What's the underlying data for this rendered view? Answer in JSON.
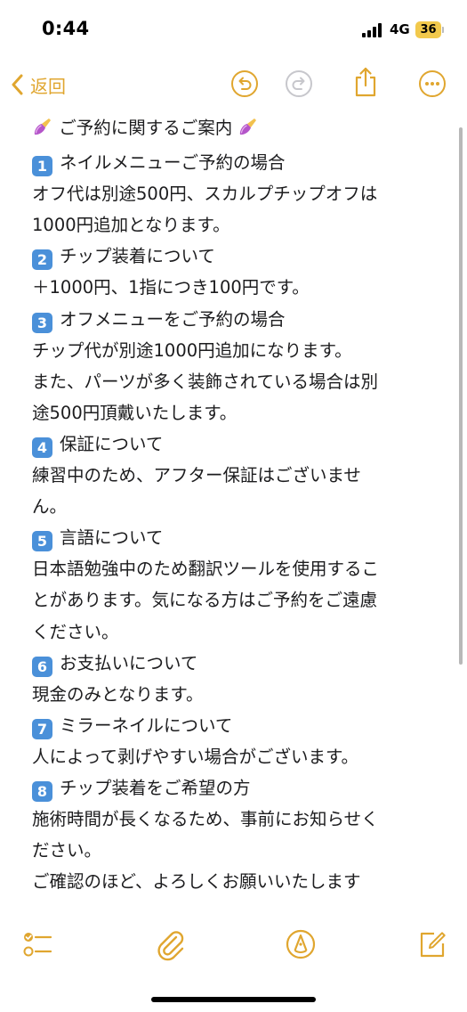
{
  "status_bar": {
    "time": "0:44",
    "network": "4G",
    "battery": "36"
  },
  "nav": {
    "back_label": "返回"
  },
  "colors": {
    "accent": "#e0a62f",
    "keycap": "#4a90d9"
  },
  "note": {
    "title": "ご予約に関するご案内",
    "sections": [
      {
        "number": "1",
        "heading": "ネイルメニューご予約の場合",
        "lines": [
          "オフ代は別途500円、スカルプチップオフは",
          "1000円追加となります。"
        ]
      },
      {
        "number": "2",
        "heading": "チップ装着について",
        "lines": [
          "＋1000円、1指につき100円です。"
        ]
      },
      {
        "number": "3",
        "heading": "オフメニューをご予約の場合",
        "lines": [
          "チップ代が別途1000円追加になります。",
          "また、パーツが多く装飾されている場合は別",
          "途500円頂戴いたします。"
        ]
      },
      {
        "number": "4",
        "heading": "保証について",
        "lines": [
          "練習中のため、アフター保証はございませ",
          "ん。"
        ]
      },
      {
        "number": "5",
        "heading": "言語について",
        "lines": [
          "日本語勉強中のため翻訳ツールを使用するこ",
          "とがあります。気になる方はご予約をご遠慮",
          "ください。"
        ]
      },
      {
        "number": "6",
        "heading": "お支払いについて",
        "lines": [
          "現金のみとなります。"
        ]
      },
      {
        "number": "7",
        "heading": "ミラーネイルについて",
        "lines": [
          "人によって剥げやすい場合がございます。"
        ]
      },
      {
        "number": "8",
        "heading": "チップ装着をご希望の方",
        "lines": [
          "施術時間が長くなるため、事前にお知らせく",
          "ださい。"
        ]
      }
    ],
    "closing": "ご確認のほど、よろしくお願いいたします"
  },
  "icons": {
    "back": "chevron-left-icon",
    "undo": "undo-icon",
    "redo": "redo-icon",
    "share": "share-icon",
    "more": "ellipsis-icon",
    "checklist": "checklist-icon",
    "attach": "paperclip-icon",
    "markup": "pen-tip-icon",
    "compose": "compose-icon",
    "nail": "nail-polish-icon"
  }
}
